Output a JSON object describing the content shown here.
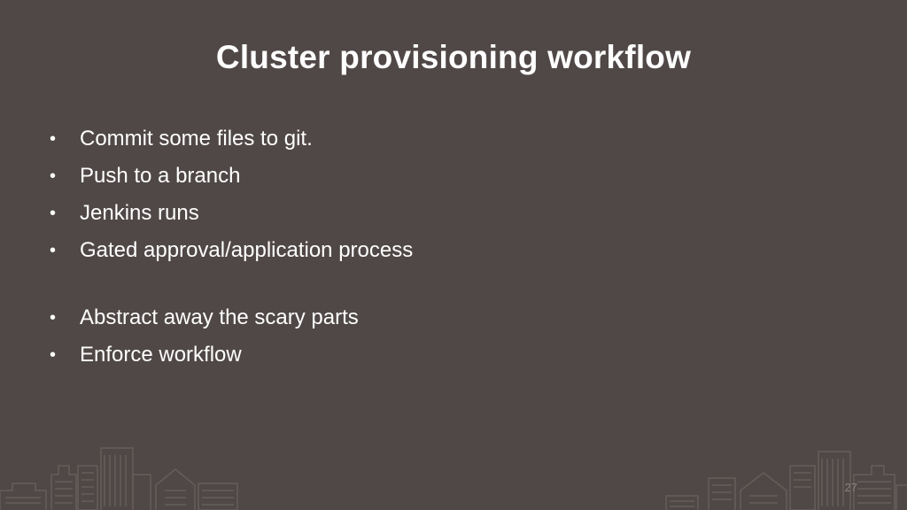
{
  "slide": {
    "title": "Cluster provisioning workflow",
    "bullets": [
      "Commit some files to git.",
      "Push to a branch",
      "Jenkins runs",
      "Gated approval/application process",
      "Abstract away the scary parts",
      "Enforce workflow"
    ],
    "bullet_symbol": "•",
    "page_number": "27"
  },
  "colors": {
    "background": "#504847",
    "text": "#ffffff",
    "skyline": "#6a615e"
  }
}
